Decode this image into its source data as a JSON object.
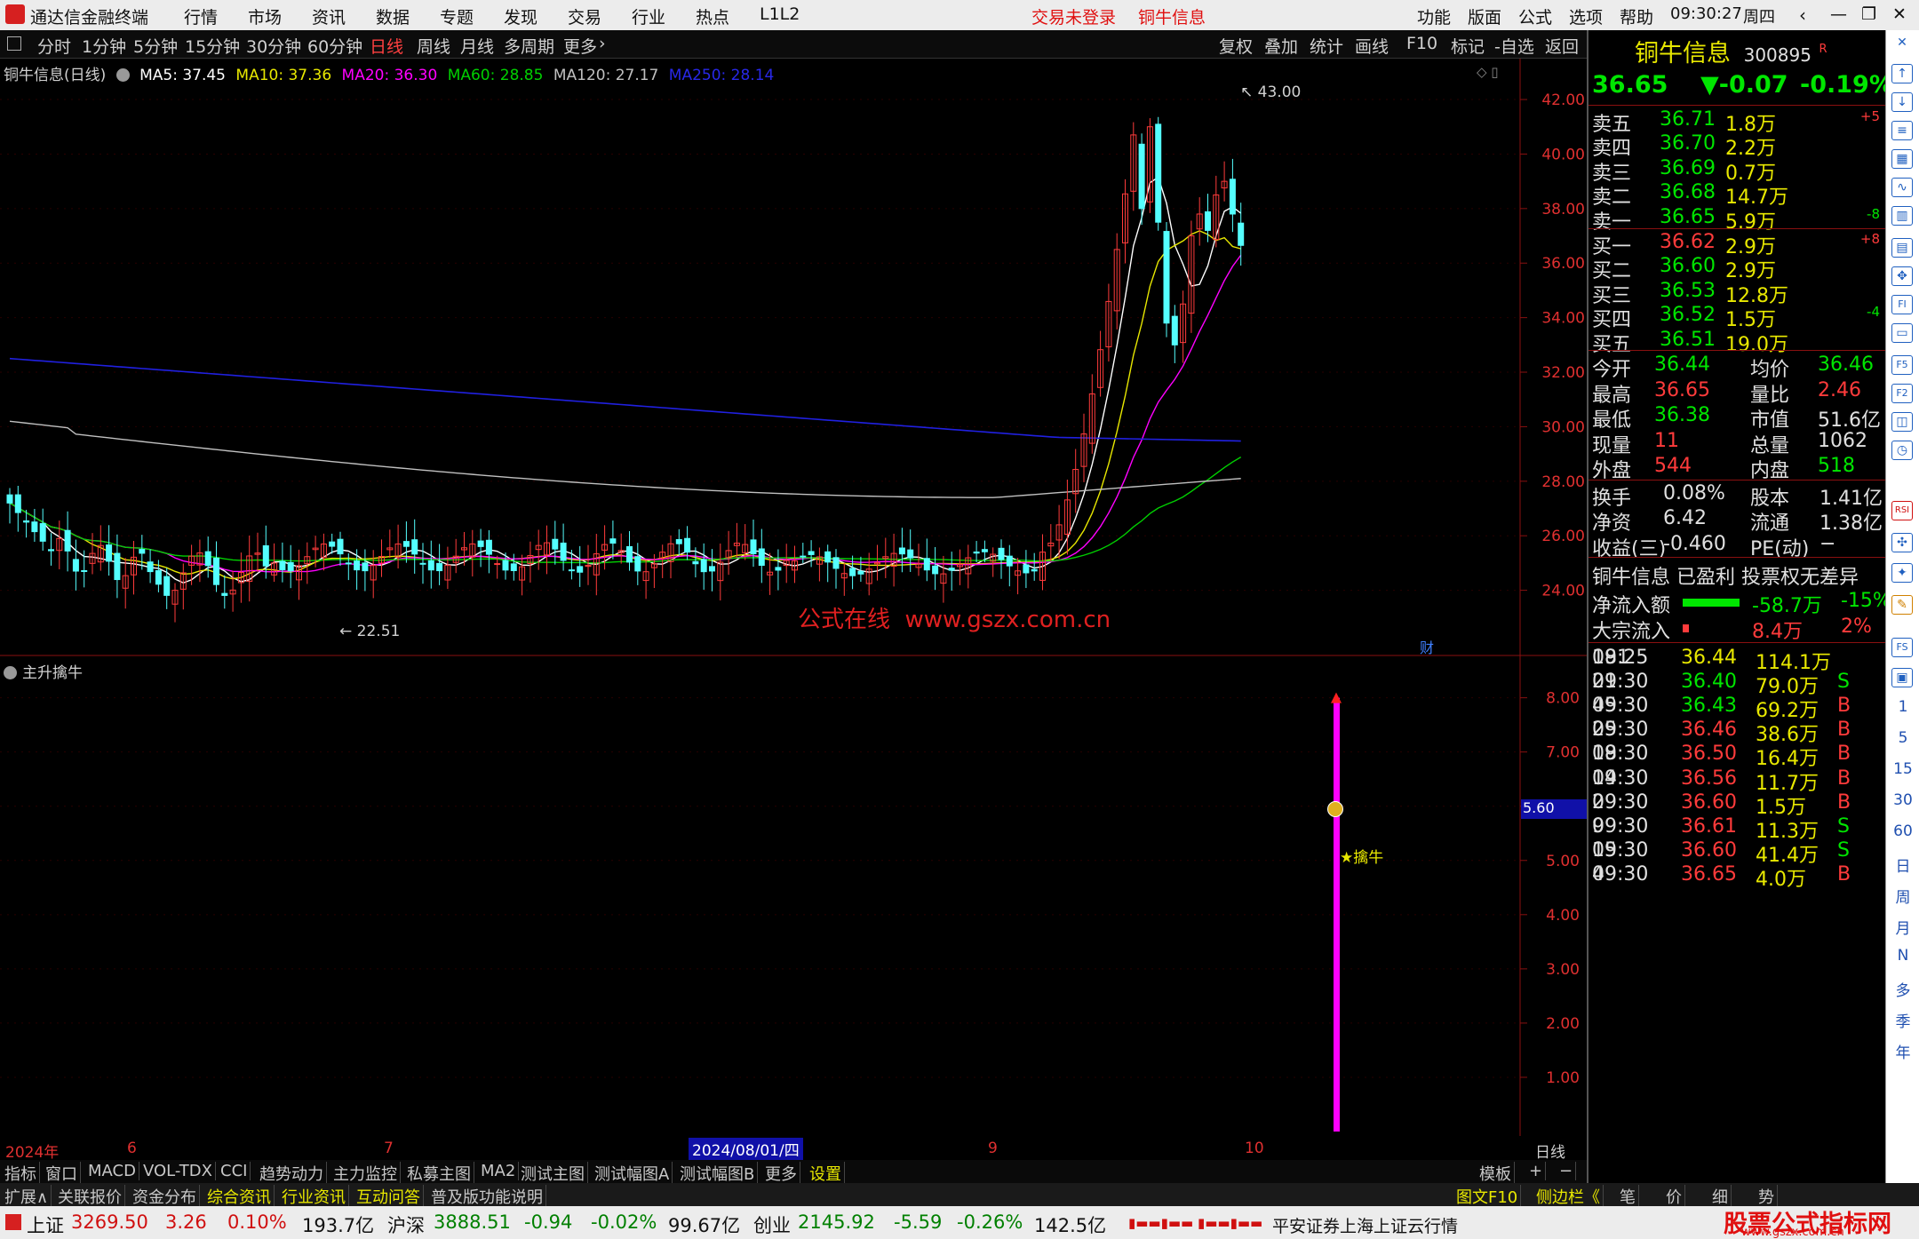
{
  "titlebar": {
    "app_title": "通达信金融终端",
    "menu": [
      "行情",
      "市场",
      "资讯",
      "数据",
      "专题",
      "发现",
      "交易",
      "行业",
      "热点",
      "L1L2"
    ],
    "trade_status": "交易未登录",
    "stock_title": "铜牛信息",
    "right_menu": [
      "功能",
      "版面",
      "公式",
      "选项",
      "帮助"
    ],
    "time": "09:30:27",
    "weekday": "周四"
  },
  "periodbar": {
    "periods": [
      "分时",
      "1分钟",
      "5分钟",
      "15分钟",
      "30分钟",
      "60分钟",
      "日线",
      "周线",
      "月线",
      "多周期",
      "更多"
    ],
    "active": "日线",
    "tools": [
      "复权",
      "叠加",
      "统计",
      "画线",
      "F10",
      "标记",
      "-自选",
      "返回"
    ]
  },
  "ma_legend": {
    "name": "铜牛信息(日线)",
    "ma5": "MA5: 37.45",
    "ma10": "MA10: 37.36",
    "ma20": "MA20: 36.30",
    "ma60": "MA60: 28.85",
    "ma120": "MA120: 27.17",
    "ma250": "MA250: 28.14"
  },
  "main_chart": {
    "high_label": "43.00",
    "low_label": "22.51",
    "watermark": "公式在线  www.gszx.com.cn",
    "cai_badge": "财"
  },
  "sub_chart": {
    "indicator_name": "主升擒牛",
    "current_value": "5.60",
    "signal_label": "擒牛"
  },
  "x_axis": {
    "labels": [
      "2024年",
      "6",
      "7",
      "2024/08/01/四",
      "9",
      "10"
    ],
    "period": "日线"
  },
  "tabbar": {
    "tabs": [
      "指标",
      "窗口",
      "MACD",
      "VOL-TDX",
      "CCI",
      "趋势动力",
      "主力监控",
      "私募主图",
      "MA2",
      "测试主图",
      "测试幅图A",
      "测试幅图B",
      "更多",
      "设置"
    ],
    "template": "模板",
    "plus": "+",
    "minus": "−"
  },
  "tabbar2": {
    "tabs": [
      "扩展∧",
      "关联报价",
      "资金分布",
      "综合资讯",
      "行业资讯",
      "互动问答",
      "普及版功能说明"
    ],
    "right_tabs": [
      "图文F10",
      "侧边栏《",
      "笔",
      "价",
      "细",
      "势"
    ]
  },
  "statusbar": {
    "indices": [
      {
        "name": "上证",
        "value": "3269.50",
        "chg": "3.26",
        "pct": "0.10%",
        "amount": "193.7亿"
      },
      {
        "name": "沪深",
        "value": "3888.51",
        "chg": "-0.94",
        "pct": "-0.02%",
        "amount": "99.67亿"
      },
      {
        "name": "创业",
        "value": "2145.92",
        "chg": "-5.59",
        "pct": "-0.26%",
        "amount": "142.5亿"
      }
    ],
    "broker": "平安证券上海上证云行情",
    "watermark": "股票公式指标网",
    "watermark_url": "www.gszx.com.cn"
  },
  "quote": {
    "name": "铜牛信息",
    "code": "300895",
    "flag": "R",
    "price": "36.65",
    "change": "▼-0.07",
    "pct": "-0.19%",
    "asks": [
      {
        "label": "卖五",
        "price": "36.71",
        "vol": "1.8万",
        "delta": "+5"
      },
      {
        "label": "卖四",
        "price": "36.70",
        "vol": "2.2万",
        "delta": ""
      },
      {
        "label": "卖三",
        "price": "36.69",
        "vol": "0.7万",
        "delta": ""
      },
      {
        "label": "卖二",
        "price": "36.68",
        "vol": "14.7万",
        "delta": ""
      },
      {
        "label": "卖一",
        "price": "36.65",
        "vol": "5.9万",
        "delta": "-8"
      }
    ],
    "bids": [
      {
        "label": "买一",
        "price": "36.62",
        "vol": "2.9万",
        "delta": "+8"
      },
      {
        "label": "买二",
        "price": "36.60",
        "vol": "2.9万",
        "delta": ""
      },
      {
        "label": "买三",
        "price": "36.53",
        "vol": "12.8万",
        "delta": ""
      },
      {
        "label": "买四",
        "price": "36.52",
        "vol": "1.5万",
        "delta": "-4"
      },
      {
        "label": "买五",
        "price": "36.51",
        "vol": "19.0万",
        "delta": ""
      }
    ],
    "stats": [
      {
        "l1": "今开",
        "v1": "36.44",
        "l2": "均价",
        "v2": "36.46"
      },
      {
        "l1": "最高",
        "v1": "36.65",
        "l2": "量比",
        "v2": "2.46"
      },
      {
        "l1": "最低",
        "v1": "36.38",
        "l2": "市值",
        "v2": "51.6亿"
      },
      {
        "l1": "现量",
        "v1": "11",
        "l2": "总量",
        "v2": "1062"
      },
      {
        "l1": "外盘",
        "v1": "544",
        "l2": "内盘",
        "v2": "518"
      }
    ],
    "fund": [
      {
        "l1": "换手",
        "v1": "0.08%",
        "l2": "股本",
        "v2": "1.41亿"
      },
      {
        "l1": "净资",
        "v1": "6.42",
        "l2": "流通",
        "v2": "1.38亿"
      },
      {
        "l1": "收益(三)",
        "v1": "-0.460",
        "l2": "PE(动)",
        "v2": "−"
      }
    ],
    "tags": "铜牛信息 已盈利 投票权无差异",
    "flows": [
      {
        "label": "净流入额",
        "value": "-58.7万",
        "pct": "-15%"
      },
      {
        "label": "大宗流入",
        "value": "8.4万",
        "pct": "2%"
      }
    ],
    "ticks": [
      {
        "t": "09:25",
        "p": "36.44",
        "v": "114.1万",
        "bs": "",
        "n": "181"
      },
      {
        "t": "09:30",
        "p": "36.40",
        "v": "79.0万",
        "bs": "S",
        "n": "21"
      },
      {
        "t": "09:30",
        "p": "36.43",
        "v": "69.2万",
        "bs": "B",
        "n": "45"
      },
      {
        "t": "09:30",
        "p": "36.46",
        "v": "38.6万",
        "bs": "B",
        "n": "25"
      },
      {
        "t": "09:30",
        "p": "36.50",
        "v": "16.4万",
        "bs": "B",
        "n": "18"
      },
      {
        "t": "09:30",
        "p": "36.56",
        "v": "11.7万",
        "bs": "B",
        "n": "14"
      },
      {
        "t": "09:30",
        "p": "36.60",
        "v": "1.5万",
        "bs": "B",
        "n": "2"
      },
      {
        "t": "09:30",
        "p": "36.61",
        "v": "11.3万",
        "bs": "S",
        "n": "9"
      },
      {
        "t": "09:30",
        "p": "36.60",
        "v": "41.4万",
        "bs": "S",
        "n": "15"
      },
      {
        "t": "09:30",
        "p": "36.65",
        "v": "4.0万",
        "bs": "B",
        "n": "4"
      }
    ]
  },
  "iconstrip": {
    "labels": [
      "1",
      "5",
      "15",
      "30",
      "60",
      "日",
      "周",
      "月",
      "N",
      "多",
      "季",
      "年"
    ]
  },
  "chart_data": [
    {
      "type": "candlestick",
      "title": "铜牛信息(日线)",
      "ylim": [
        22,
        43.5
      ],
      "y_ticks": [
        24,
        26,
        28,
        30,
        32,
        34,
        36,
        38,
        40,
        42
      ],
      "high": 43.0,
      "low": 22.51,
      "last_close": 36.65,
      "ma_series": [
        {
          "name": "MA5",
          "value": 37.45,
          "color": "#ffffff"
        },
        {
          "name": "MA10",
          "value": 37.36,
          "color": "#e8e800"
        },
        {
          "name": "MA20",
          "value": 36.3,
          "color": "#ff00ff"
        },
        {
          "name": "MA60",
          "value": 28.85,
          "color": "#00d000"
        },
        {
          "name": "MA120",
          "value": 27.17,
          "color": "#c0c0c0"
        },
        {
          "name": "MA250",
          "value": 28.14,
          "color": "#2020e0"
        }
      ]
    },
    {
      "type": "bar",
      "title": "主升擒牛",
      "ylim": [
        0,
        8.6
      ],
      "y_ticks": [
        1,
        2,
        3,
        4,
        5,
        6,
        7,
        8
      ],
      "signal_value": 8.0,
      "current_value": 5.6,
      "color": "#ff00ff"
    }
  ]
}
